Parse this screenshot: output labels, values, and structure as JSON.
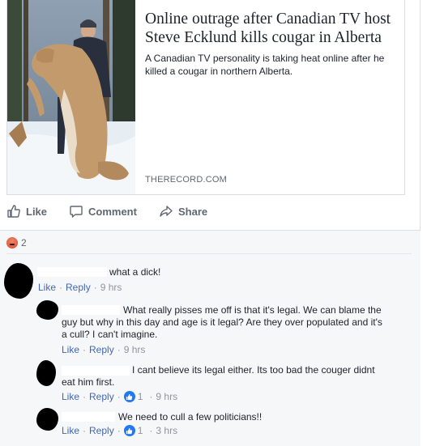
{
  "preview": {
    "headline": "Online outrage after Canadian TV host Steve Ecklund kills cougar in Alberta",
    "description": "A Canadian TV personality is taking heat online after he killed a cougar in northern Alberta.",
    "domain": "THERECORD.COM"
  },
  "actions": {
    "like": "Like",
    "comment": "Comment",
    "share": "Share"
  },
  "reactions": {
    "angry_count": "2"
  },
  "comments": [
    {
      "text": "what a dick!",
      "like": "Like",
      "reply": "Reply",
      "time": "9 hrs"
    },
    {
      "text": "What really pisses me off is that it's legal. We can blame the guy but why in this day and age is it legal? Are they over populated and it's a cull? I can't imagine.",
      "like": "Like",
      "reply": "Reply",
      "time": "9 hrs"
    },
    {
      "text": "I cant believe its legal either. Its too bad the couger didnt eat him first.",
      "like": "Like",
      "reply": "Reply",
      "likes": "1",
      "time": "9 hrs"
    },
    {
      "text": "We need to cull a few politicians!!",
      "like": "Like",
      "reply": "Reply",
      "likes": "1",
      "time": "3 hrs"
    }
  ],
  "separator": "·",
  "colors": {
    "link": "#4267b2",
    "meta": "#90949c",
    "like_badge": "#2078f4",
    "angry": "#e9710f"
  },
  "icons": [
    "thumbs-up-icon",
    "comment-bubble-icon",
    "share-arrow-icon",
    "angry-reaction-icon",
    "like-badge-icon"
  ]
}
